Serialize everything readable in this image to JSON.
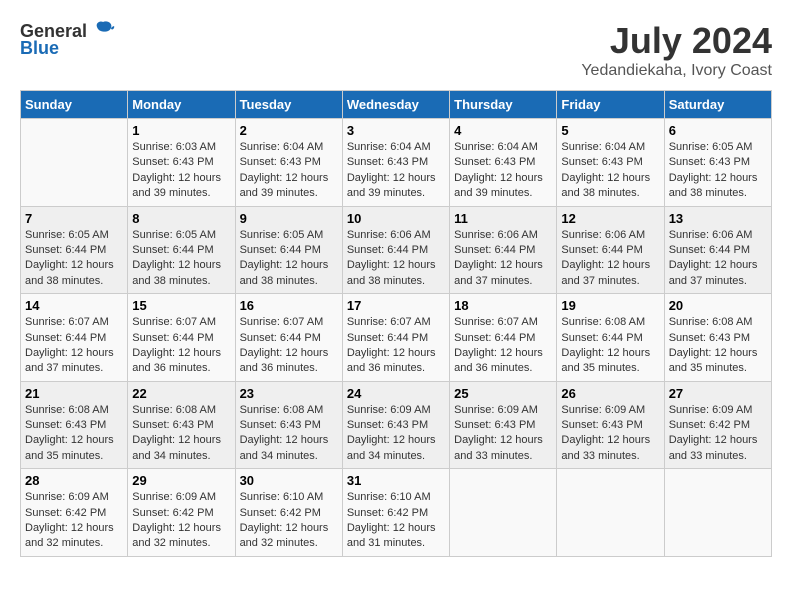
{
  "header": {
    "logo_general": "General",
    "logo_blue": "Blue",
    "month_year": "July 2024",
    "location": "Yedandiekaha, Ivory Coast"
  },
  "calendar": {
    "days_of_week": [
      "Sunday",
      "Monday",
      "Tuesday",
      "Wednesday",
      "Thursday",
      "Friday",
      "Saturday"
    ],
    "weeks": [
      [
        {
          "day": "",
          "info": ""
        },
        {
          "day": "1",
          "info": "Sunrise: 6:03 AM\nSunset: 6:43 PM\nDaylight: 12 hours\nand 39 minutes."
        },
        {
          "day": "2",
          "info": "Sunrise: 6:04 AM\nSunset: 6:43 PM\nDaylight: 12 hours\nand 39 minutes."
        },
        {
          "day": "3",
          "info": "Sunrise: 6:04 AM\nSunset: 6:43 PM\nDaylight: 12 hours\nand 39 minutes."
        },
        {
          "day": "4",
          "info": "Sunrise: 6:04 AM\nSunset: 6:43 PM\nDaylight: 12 hours\nand 39 minutes."
        },
        {
          "day": "5",
          "info": "Sunrise: 6:04 AM\nSunset: 6:43 PM\nDaylight: 12 hours\nand 38 minutes."
        },
        {
          "day": "6",
          "info": "Sunrise: 6:05 AM\nSunset: 6:43 PM\nDaylight: 12 hours\nand 38 minutes."
        }
      ],
      [
        {
          "day": "7",
          "info": "Sunrise: 6:05 AM\nSunset: 6:44 PM\nDaylight: 12 hours\nand 38 minutes."
        },
        {
          "day": "8",
          "info": "Sunrise: 6:05 AM\nSunset: 6:44 PM\nDaylight: 12 hours\nand 38 minutes."
        },
        {
          "day": "9",
          "info": "Sunrise: 6:05 AM\nSunset: 6:44 PM\nDaylight: 12 hours\nand 38 minutes."
        },
        {
          "day": "10",
          "info": "Sunrise: 6:06 AM\nSunset: 6:44 PM\nDaylight: 12 hours\nand 38 minutes."
        },
        {
          "day": "11",
          "info": "Sunrise: 6:06 AM\nSunset: 6:44 PM\nDaylight: 12 hours\nand 37 minutes."
        },
        {
          "day": "12",
          "info": "Sunrise: 6:06 AM\nSunset: 6:44 PM\nDaylight: 12 hours\nand 37 minutes."
        },
        {
          "day": "13",
          "info": "Sunrise: 6:06 AM\nSunset: 6:44 PM\nDaylight: 12 hours\nand 37 minutes."
        }
      ],
      [
        {
          "day": "14",
          "info": "Sunrise: 6:07 AM\nSunset: 6:44 PM\nDaylight: 12 hours\nand 37 minutes."
        },
        {
          "day": "15",
          "info": "Sunrise: 6:07 AM\nSunset: 6:44 PM\nDaylight: 12 hours\nand 36 minutes."
        },
        {
          "day": "16",
          "info": "Sunrise: 6:07 AM\nSunset: 6:44 PM\nDaylight: 12 hours\nand 36 minutes."
        },
        {
          "day": "17",
          "info": "Sunrise: 6:07 AM\nSunset: 6:44 PM\nDaylight: 12 hours\nand 36 minutes."
        },
        {
          "day": "18",
          "info": "Sunrise: 6:07 AM\nSunset: 6:44 PM\nDaylight: 12 hours\nand 36 minutes."
        },
        {
          "day": "19",
          "info": "Sunrise: 6:08 AM\nSunset: 6:44 PM\nDaylight: 12 hours\nand 35 minutes."
        },
        {
          "day": "20",
          "info": "Sunrise: 6:08 AM\nSunset: 6:43 PM\nDaylight: 12 hours\nand 35 minutes."
        }
      ],
      [
        {
          "day": "21",
          "info": "Sunrise: 6:08 AM\nSunset: 6:43 PM\nDaylight: 12 hours\nand 35 minutes."
        },
        {
          "day": "22",
          "info": "Sunrise: 6:08 AM\nSunset: 6:43 PM\nDaylight: 12 hours\nand 34 minutes."
        },
        {
          "day": "23",
          "info": "Sunrise: 6:08 AM\nSunset: 6:43 PM\nDaylight: 12 hours\nand 34 minutes."
        },
        {
          "day": "24",
          "info": "Sunrise: 6:09 AM\nSunset: 6:43 PM\nDaylight: 12 hours\nand 34 minutes."
        },
        {
          "day": "25",
          "info": "Sunrise: 6:09 AM\nSunset: 6:43 PM\nDaylight: 12 hours\nand 33 minutes."
        },
        {
          "day": "26",
          "info": "Sunrise: 6:09 AM\nSunset: 6:43 PM\nDaylight: 12 hours\nand 33 minutes."
        },
        {
          "day": "27",
          "info": "Sunrise: 6:09 AM\nSunset: 6:42 PM\nDaylight: 12 hours\nand 33 minutes."
        }
      ],
      [
        {
          "day": "28",
          "info": "Sunrise: 6:09 AM\nSunset: 6:42 PM\nDaylight: 12 hours\nand 32 minutes."
        },
        {
          "day": "29",
          "info": "Sunrise: 6:09 AM\nSunset: 6:42 PM\nDaylight: 12 hours\nand 32 minutes."
        },
        {
          "day": "30",
          "info": "Sunrise: 6:10 AM\nSunset: 6:42 PM\nDaylight: 12 hours\nand 32 minutes."
        },
        {
          "day": "31",
          "info": "Sunrise: 6:10 AM\nSunset: 6:42 PM\nDaylight: 12 hours\nand 31 minutes."
        },
        {
          "day": "",
          "info": ""
        },
        {
          "day": "",
          "info": ""
        },
        {
          "day": "",
          "info": ""
        }
      ]
    ]
  }
}
